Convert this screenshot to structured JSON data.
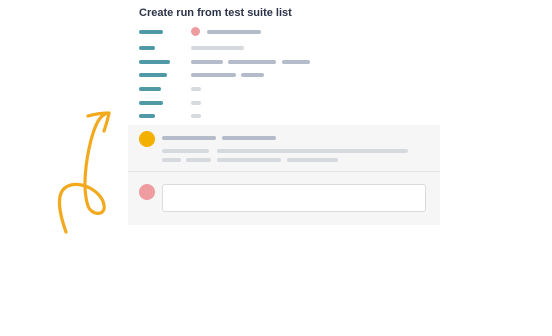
{
  "header": {
    "title": "Create run from test suite list"
  },
  "colors": {
    "teal_line": "#4f9aa6",
    "placeholder_line": "#b3bcc8",
    "faint_line": "#d6dadf",
    "status_dot_pink": "#ef9ca1",
    "comment_dot_orange": "#f4b000",
    "input_dot_pink": "#ef9ca1",
    "arrow_orange": "#f3a91e",
    "panel_bg": "#f6f6f6"
  },
  "icons": {
    "arrow": "hand-drawn-arrow-icon"
  }
}
